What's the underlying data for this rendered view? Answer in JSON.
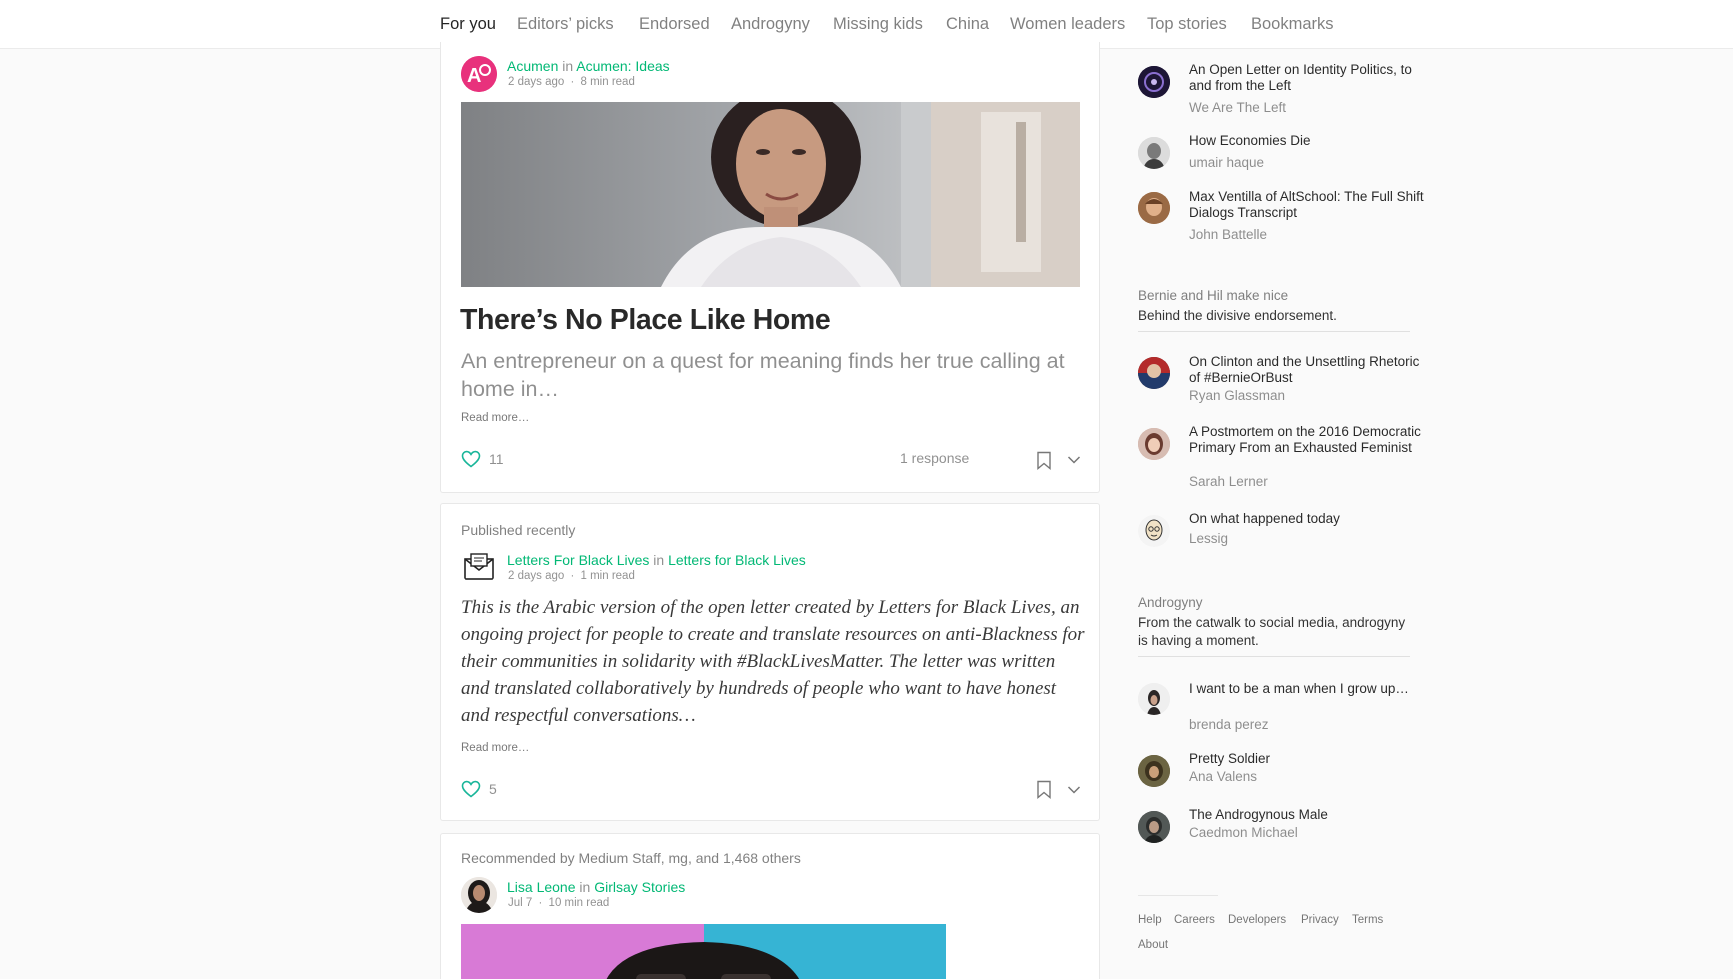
{
  "nav": {
    "tabs": [
      "For you",
      "Editors’ picks",
      "Endorsed",
      "Androgyny",
      "Missing kids",
      "China",
      "Women leaders",
      "Top stories",
      "Bookmarks"
    ],
    "active": "For you"
  },
  "posts": [
    {
      "author": "Acumen",
      "in": "in",
      "publication": "Acumen: Ideas",
      "date": "2 days ago",
      "sep": "·",
      "read_time": "8 min read",
      "title": "There’s No Place Like Home",
      "subtitle": "An entrepreneur on a quest for meaning finds her true calling at home in…",
      "read_more": "Read more…",
      "likes": "11",
      "responses": "1 response"
    },
    {
      "section_label": "Published recently",
      "author": "Letters For Black Lives",
      "in": "in",
      "publication": "Letters for Black Lives",
      "date": "2 days ago",
      "sep": "·",
      "read_time": "1 min read",
      "excerpt": "This is the Arabic version of the open letter created by Letters for Black Lives, an ongoing project for people to create and translate resources on anti-Blackness for their communities in solidarity with #BlackLivesMatter. The letter was written and translated collaboratively by hundreds of people who want to have honest and respectful conversations…",
      "read_more": "Read more…",
      "likes": "5"
    },
    {
      "section_label": "Recommended by Medium Staff, mg, and 1,468 others",
      "author": "Lisa Leone",
      "in": "in",
      "publication": "Girlsay Stories",
      "date": "Jul 7",
      "sep": "·",
      "read_time": "10 min read"
    }
  ],
  "sidebar": {
    "top_items": [
      {
        "title": "An Open Letter on Identity Politics, to and from the Left",
        "author": "We Are The Left"
      },
      {
        "title": "How Economies Die",
        "author": "umair haque"
      },
      {
        "title": "Max Ventilla of AltSchool: The Full Shift Dialogs Transcript",
        "author": "John Battelle"
      }
    ],
    "sections": [
      {
        "heading": "Bernie and Hil make nice",
        "description": "Behind the divisive endorsement.",
        "items": [
          {
            "title": "On Clinton and the Unsettling Rhetoric of #BernieOrBust",
            "author": "Ryan Glassman"
          },
          {
            "title": "A Postmortem on the 2016 Democratic Primary From an Exhausted Feminist",
            "author": "Sarah Lerner"
          },
          {
            "title": "On what happened today",
            "author": "Lessig"
          }
        ]
      },
      {
        "heading": "Androgyny",
        "description": "From the catwalk to social media, androgyny is having a moment.",
        "items": [
          {
            "title": "I want to be a man when I grow up…",
            "author": "brenda perez"
          },
          {
            "title": "Pretty Soldier",
            "author": "Ana Valens"
          },
          {
            "title": "The Androgynous Male",
            "author": "Caedmon Michael"
          }
        ]
      }
    ]
  },
  "footer": {
    "links": [
      "Help",
      "Careers",
      "Developers",
      "Privacy",
      "Terms",
      "About"
    ]
  },
  "colors": {
    "accent": "#02b875",
    "like_icon": "#1ab69a"
  }
}
